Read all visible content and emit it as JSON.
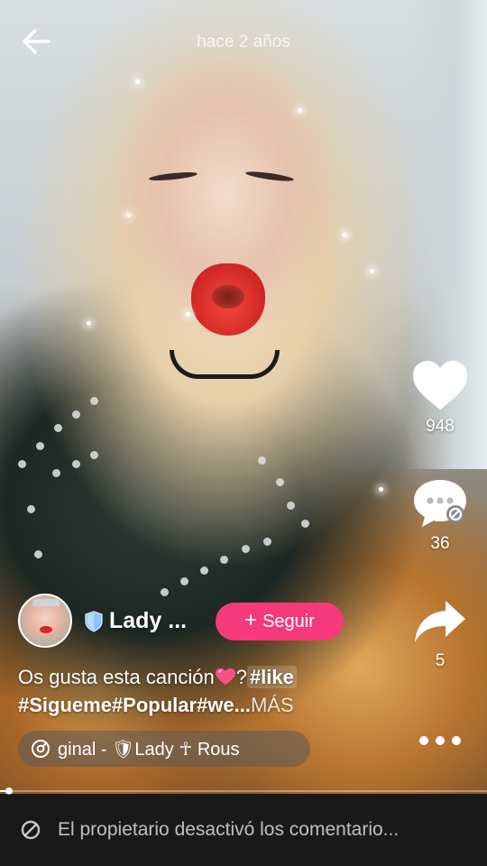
{
  "header": {
    "timestamp": "hace 2 años"
  },
  "author": {
    "name": "Lady ...",
    "follow_label": "Seguir"
  },
  "actions": {
    "likes": "948",
    "comments": "36",
    "shares": "5"
  },
  "caption": {
    "text_1": "Os gusta esta canción",
    "question": "?",
    "tag_like": "#like",
    "tags_line_2": "#Sigueme#Popular#we...",
    "more_label": "MÁS"
  },
  "music": {
    "text": "ginal - 🛡Lady ☥ Rous"
  },
  "playback": {
    "progress_fraction": 0.02
  },
  "comments_bar": {
    "text": "El propietario desactivó los comentario..."
  },
  "colors": {
    "follow_button": "#f53a7b",
    "verified_shield": "#8fc3ff"
  },
  "icons": [
    "back-arrow-icon",
    "heart-icon",
    "comment-disabled-icon",
    "share-icon",
    "more-icon",
    "shield-icon",
    "heart-emoji-icon",
    "music-disc-icon",
    "comments-off-icon"
  ]
}
